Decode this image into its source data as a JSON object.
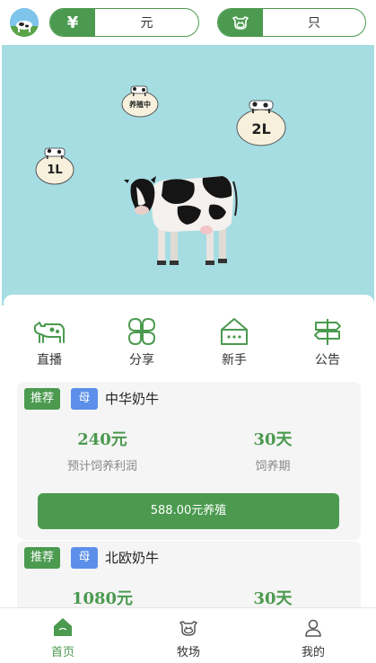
{
  "header": {
    "currency_symbol": "¥",
    "currency_unit": "元",
    "count_unit": "只",
    "avatar": "farm-avatar",
    "cow_icon": "cow-face-icon"
  },
  "scene": {
    "bubbles": [
      {
        "label": "养殖中"
      },
      {
        "label": "2L"
      },
      {
        "label": "1L"
      }
    ]
  },
  "quick_links": [
    {
      "label": "直播",
      "icon": "cow-icon"
    },
    {
      "label": "分享",
      "icon": "clover-icon"
    },
    {
      "label": "新手",
      "icon": "house-icon"
    },
    {
      "label": "公告",
      "icon": "signpost-icon"
    }
  ],
  "products": [
    {
      "tag": "推荐",
      "sex": "母",
      "name": "中华奶牛",
      "profit": "240元",
      "profit_label": "预计饲养利润",
      "period": "30天",
      "period_label": "饲养期",
      "button": "588.00元养殖"
    },
    {
      "tag": "推荐",
      "sex": "母",
      "name": "北欧奶牛",
      "profit": "1080元",
      "period": "30天"
    }
  ],
  "tabbar": {
    "items": [
      {
        "label": "首页",
        "icon": "home-icon",
        "active": true
      },
      {
        "label": "牧场",
        "icon": "cow-face-icon",
        "active": false
      },
      {
        "label": "我的",
        "icon": "user-icon",
        "active": false
      }
    ],
    "active_color": "#4b9a4f"
  },
  "colors": {
    "brand": "#4b9a4f",
    "sky": "#a6dde3",
    "tag_blue": "#5b8fe9"
  }
}
